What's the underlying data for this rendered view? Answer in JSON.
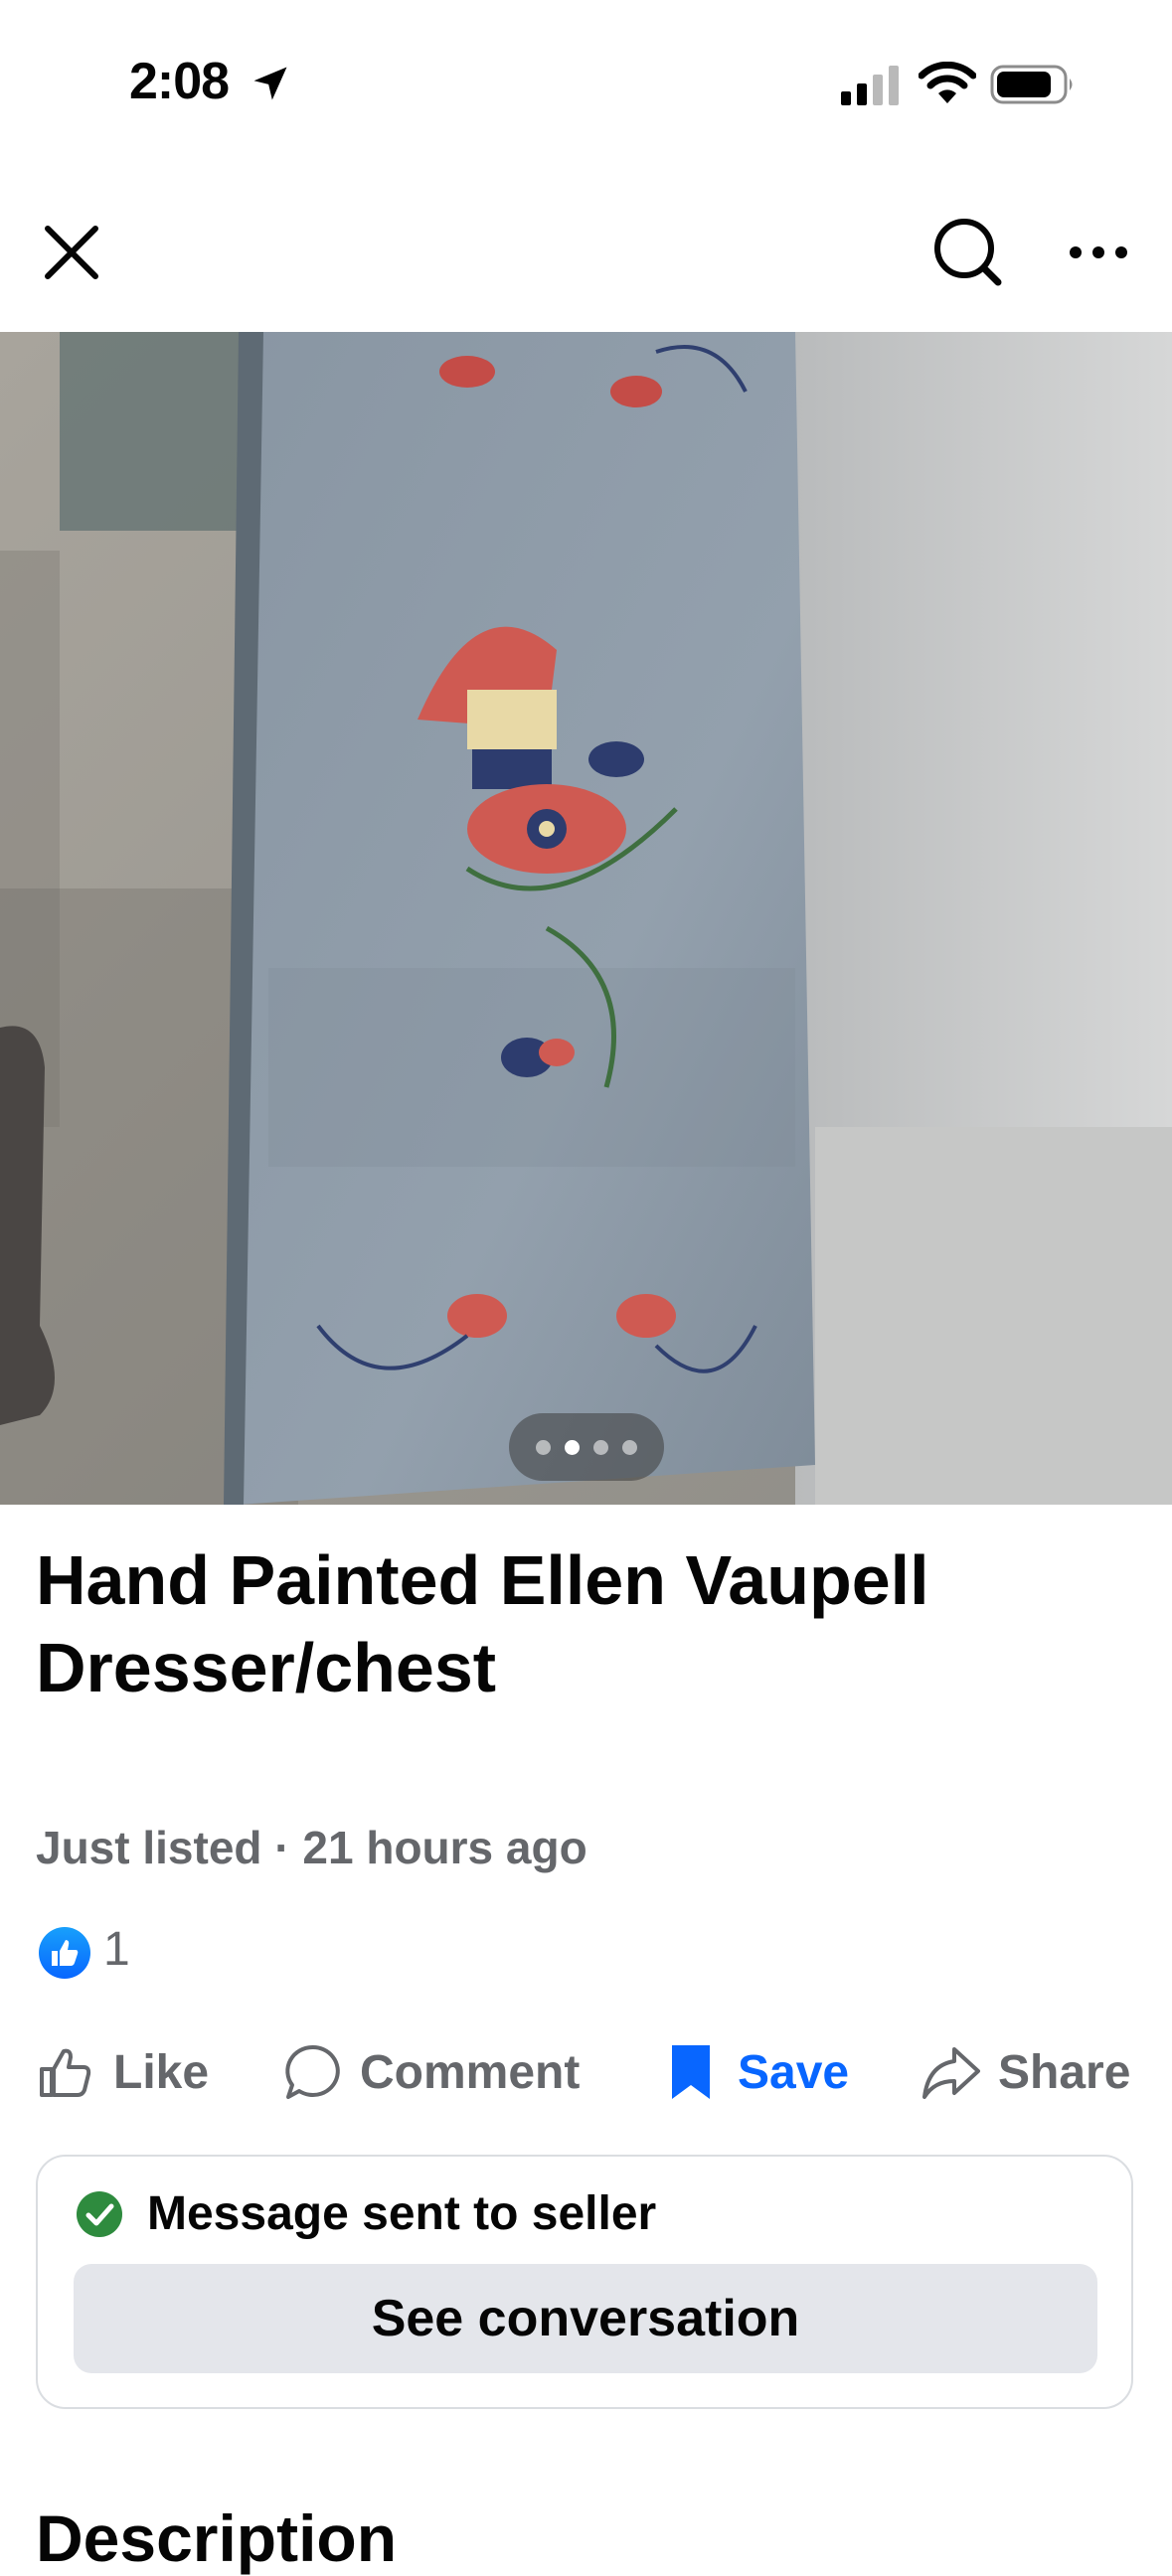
{
  "status_bar": {
    "time": "2:08"
  },
  "header": {
    "icons": [
      "close-icon",
      "search-icon",
      "more-icon"
    ]
  },
  "photo": {
    "pager": {
      "count": 4,
      "active_index": 1
    }
  },
  "listing": {
    "title": "Hand Painted Ellen Vaupell Dresser/chest",
    "listed_label": "Just listed",
    "separator": "·",
    "time_ago": "21 hours ago",
    "like_count": "1"
  },
  "actions": {
    "like": "Like",
    "comment": "Comment",
    "save": "Save",
    "share": "Share"
  },
  "message_card": {
    "status": "Message sent to seller",
    "button": "See conversation"
  },
  "section": {
    "description_heading": "Description"
  },
  "colors": {
    "accent": "#0866ff",
    "secondary_text": "#65676b",
    "success": "#2e8b3e",
    "button_bg": "#e4e6eb"
  }
}
